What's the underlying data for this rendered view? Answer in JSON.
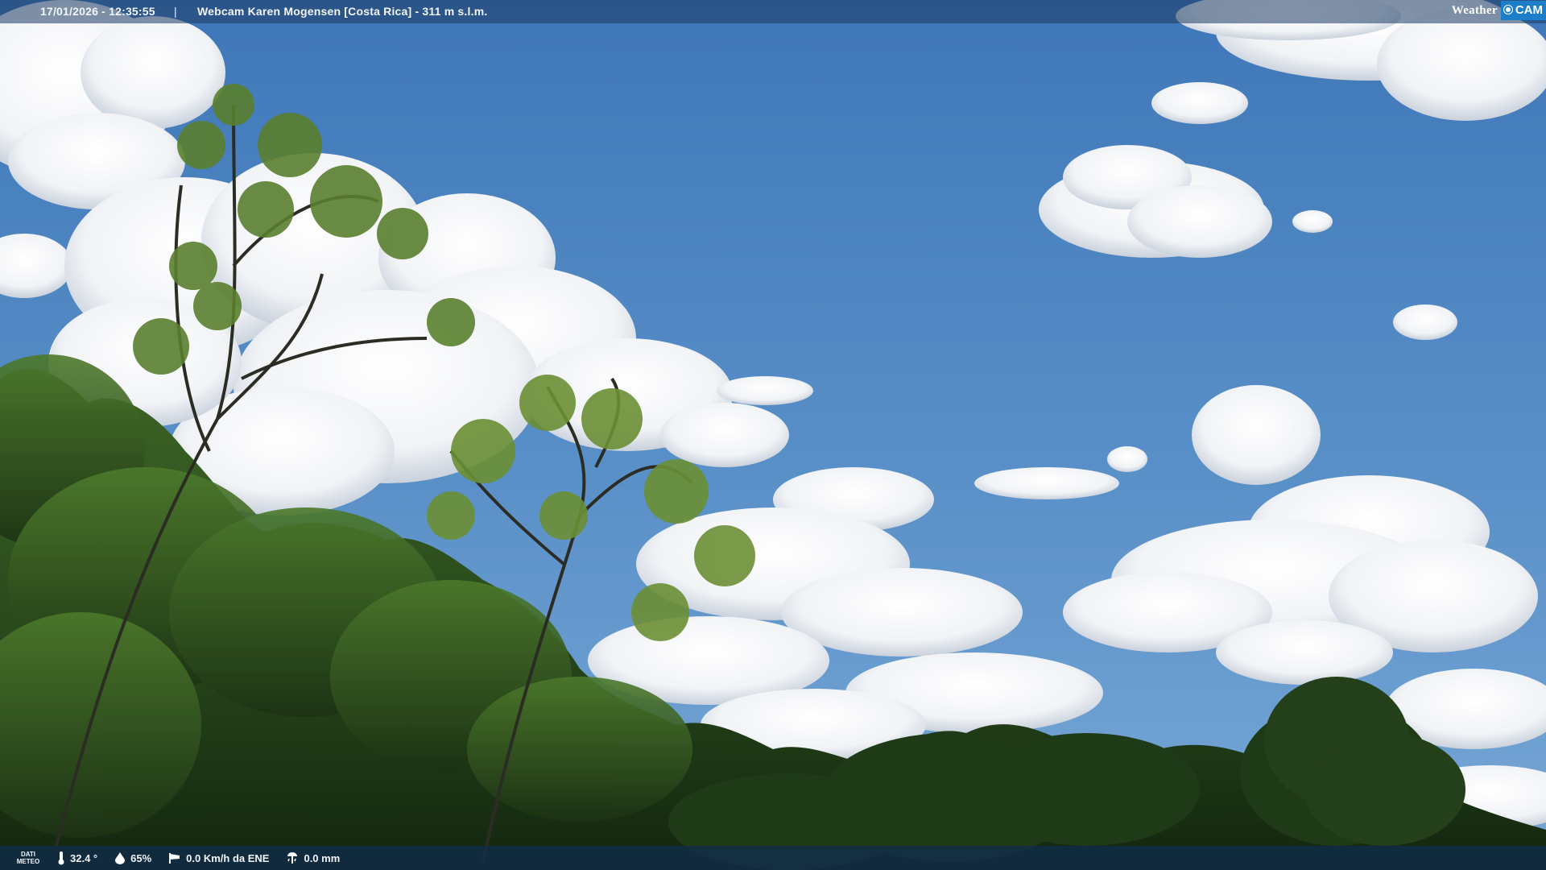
{
  "overlay": {
    "timestamp": "17/01/2026 - 12:35:55",
    "separator": "|",
    "camera_title": "Webcam Karen Mogensen [Costa Rica] - 311 m s.l.m.",
    "brand": {
      "weather": "Weather",
      "cam": "CAM"
    }
  },
  "meteo": {
    "label_line1": "DATI",
    "label_line2": "METEO",
    "temperature": "32.4 °",
    "humidity": "65%",
    "wind": "0.0 Km/h da ENE",
    "rain": "0.0 mm"
  },
  "icons": {
    "temperature": "thermometer-icon",
    "humidity": "water-drop-icon",
    "wind": "wind-sock-icon",
    "rain": "rain-gauge-icon",
    "brand_lens": "camera-lens-icon"
  },
  "colors": {
    "sky_top": "#3f76b8",
    "sky_bottom": "#7aa8d6",
    "foliage_dark": "#1f3a1a",
    "foliage_light": "#4f7a2e",
    "brand_accent": "#1c7ec8"
  }
}
